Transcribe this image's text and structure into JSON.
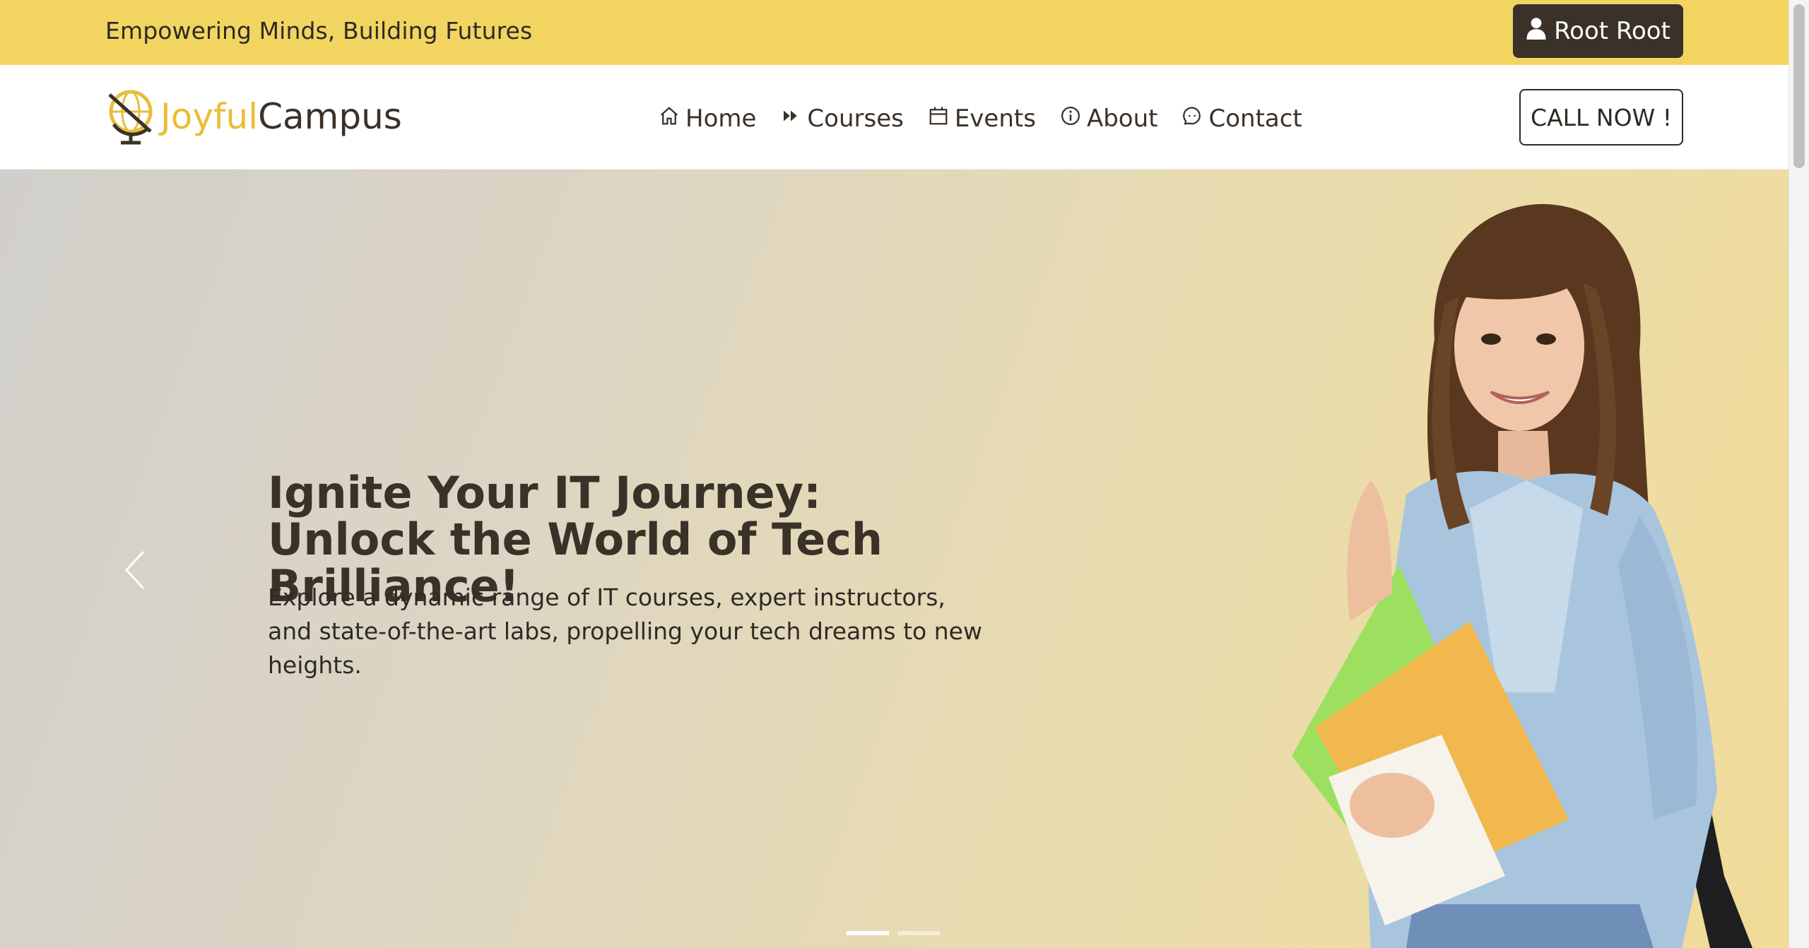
{
  "topbar": {
    "tagline": "Empowering Minds, Building Futures",
    "user_label": "Root Root"
  },
  "logo": {
    "part1": "Joyful",
    "part2": "Campus"
  },
  "nav": {
    "items": [
      {
        "label": "Home",
        "icon": "home-icon"
      },
      {
        "label": "Courses",
        "icon": "fast-forward-icon"
      },
      {
        "label": "Events",
        "icon": "calendar-icon"
      },
      {
        "label": "About",
        "icon": "info-icon"
      },
      {
        "label": "Contact",
        "icon": "chat-icon"
      }
    ],
    "call_label": "CALL NOW !"
  },
  "hero": {
    "title": "Ignite Your IT Journey: Unlock the World of Tech Brilliance!",
    "text": "Explore a dynamic range of IT courses, expert instructors, and state-of-the-art labs, propelling your tech dreams to new heights.",
    "slides_count": 2,
    "active_slide": 1
  },
  "colors": {
    "topbar": "#f2d561",
    "dark": "#3a3129",
    "accent": "#e9bd3a"
  }
}
